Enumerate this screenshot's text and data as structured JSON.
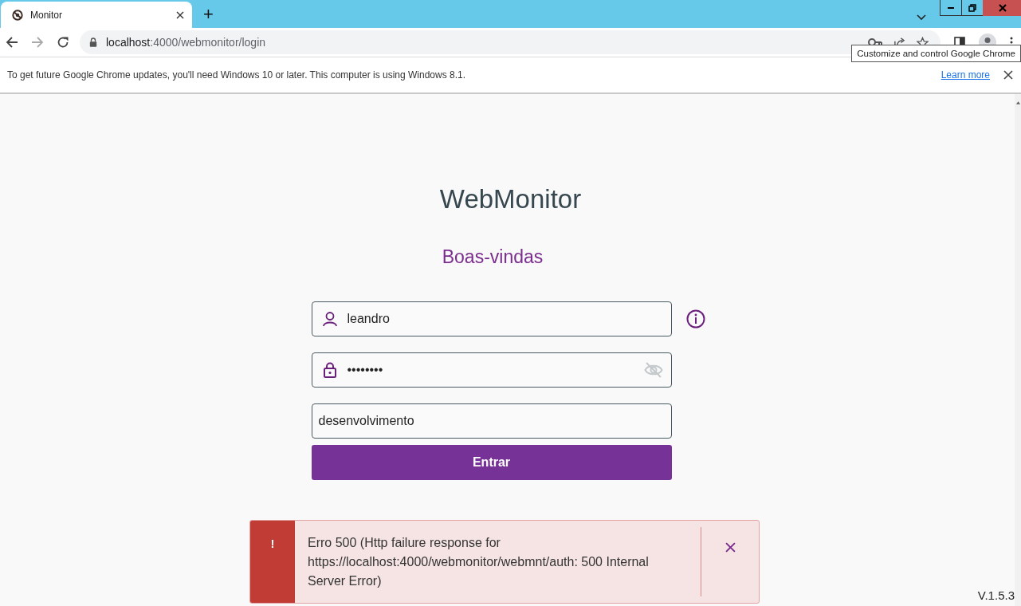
{
  "browser": {
    "tabs": [
      {
        "title": "Monitor",
        "selected": true
      }
    ],
    "new_tab": "+",
    "address": {
      "host": "localhost",
      "path": ":4000/webmonitor/login"
    },
    "tooltip": "Customize and control Google Chrome",
    "infobar": {
      "message": "To get future Google Chrome updates, you'll need Windows 10 or later. This computer is using Windows 8.1.",
      "link": "Learn more"
    }
  },
  "page": {
    "app_title": "WebMonitor",
    "welcome": "Boas-vindas",
    "fields": [
      {
        "kind": "username",
        "value": "leandro"
      },
      {
        "kind": "password",
        "value": "••••••••"
      },
      {
        "kind": "text",
        "value": "desenvolvimento"
      }
    ],
    "submit": "Entrar",
    "toast": {
      "marker": "!",
      "message": "Erro 500 (Http failure response for https://localhost:4000/webmonitor/webmnt/auth: 500 Internal Server Error)"
    },
    "version": "V.1.5.3"
  }
}
